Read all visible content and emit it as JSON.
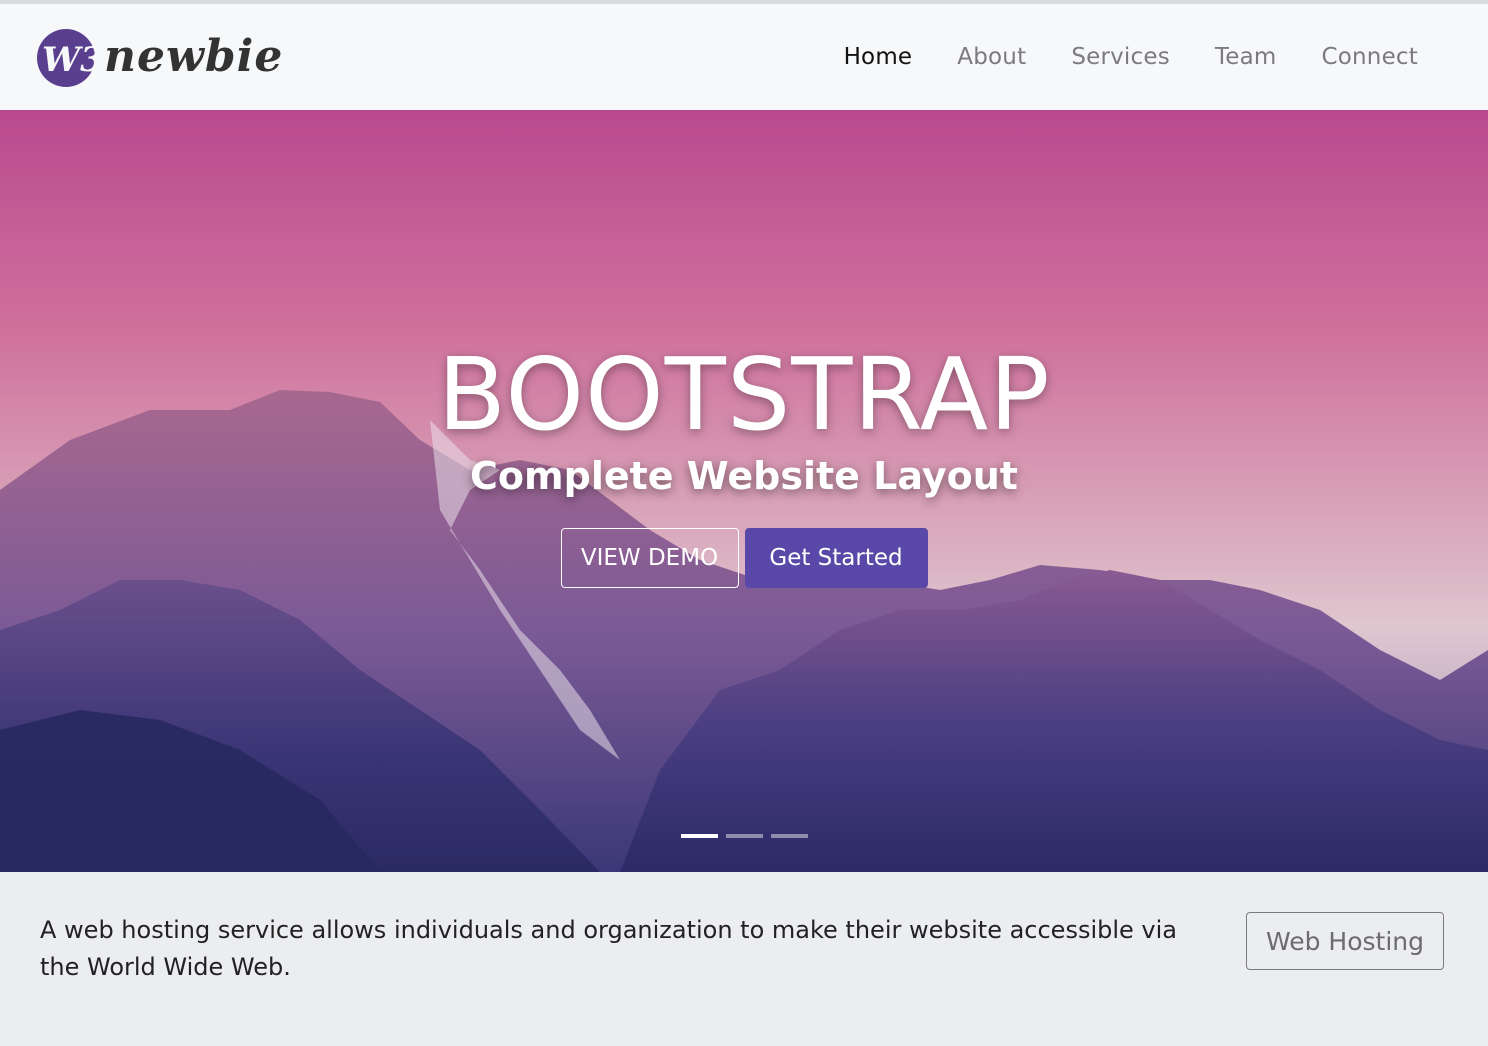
{
  "brand": {
    "mark_text": "W3",
    "name": "newbie",
    "mark_color": "#5a3f8f"
  },
  "nav": {
    "items": [
      {
        "label": "Home",
        "active": true
      },
      {
        "label": "About",
        "active": false
      },
      {
        "label": "Services",
        "active": false
      },
      {
        "label": "Team",
        "active": false
      },
      {
        "label": "Connect",
        "active": false
      }
    ]
  },
  "hero": {
    "title": "BOOTSTRAP",
    "subtitle": "Complete Website Layout",
    "demo_button": "VIEW DEMO",
    "start_button": "Get Started",
    "slides": {
      "count": 3,
      "active": 1
    },
    "accent": "#5a48a8"
  },
  "jumbotron": {
    "text": "A web hosting service allows individuals and organization to make their website accessible via the World Wide Web.",
    "button": "Web Hosting"
  }
}
